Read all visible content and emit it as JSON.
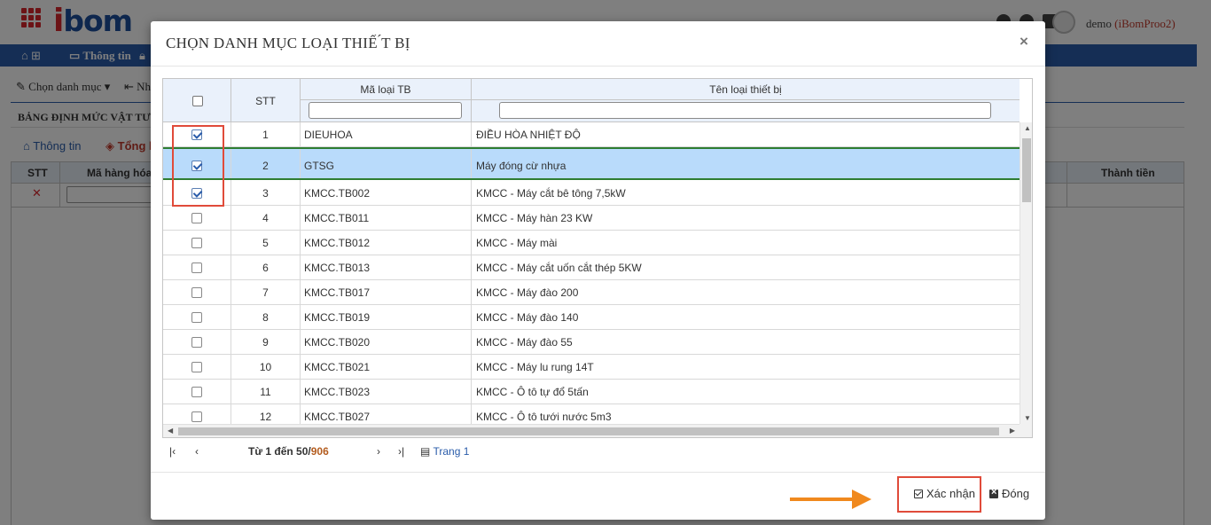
{
  "app": {
    "logo": "ibom",
    "user": "demo",
    "user_org": "(iBomProo2)",
    "nav": [
      "Thông tin"
    ],
    "toolbar": {
      "choose": "Chọn danh mục",
      "import": "Nh"
    },
    "section_title": "BẢNG ĐỊNH MỨC VẬT TƯ N",
    "tabs": [
      "Thông tin",
      "Tổng h"
    ],
    "bg_grid": {
      "headers": [
        "STT",
        "Mã hàng hóa",
        "Thành tiền"
      ]
    }
  },
  "modal": {
    "title": "CHỌN DANH MỤC LOẠI THIẾ ́T BỊ",
    "columns": {
      "stt": "STT",
      "code": "Mã loại TB",
      "name": "Tên loại thiết bị"
    },
    "rows": [
      {
        "stt": "1",
        "code": "DIEUHOA",
        "name": "ĐIỀU HÒA NHIỆT ĐỘ",
        "checked": true,
        "selected": false
      },
      {
        "stt": "2",
        "code": "GTSG",
        "name": "Máy đóng cừ nhựa",
        "checked": true,
        "selected": true
      },
      {
        "stt": "3",
        "code": "KMCC.TB002",
        "name": "KMCC - Máy cắt bê tông 7,5kW",
        "checked": true,
        "selected": false
      },
      {
        "stt": "4",
        "code": "KMCC.TB011",
        "name": "KMCC - Máy hàn 23 KW",
        "checked": false,
        "selected": false
      },
      {
        "stt": "5",
        "code": "KMCC.TB012",
        "name": "KMCC - Máy mài",
        "checked": false,
        "selected": false
      },
      {
        "stt": "6",
        "code": "KMCC.TB013",
        "name": "KMCC - Máy cắt uốn cắt thép 5KW",
        "checked": false,
        "selected": false
      },
      {
        "stt": "7",
        "code": "KMCC.TB017",
        "name": "KMCC - Máy đào 200",
        "checked": false,
        "selected": false
      },
      {
        "stt": "8",
        "code": "KMCC.TB019",
        "name": "KMCC - Máy đào 140",
        "checked": false,
        "selected": false
      },
      {
        "stt": "9",
        "code": "KMCC.TB020",
        "name": "KMCC - Máy đào 55",
        "checked": false,
        "selected": false
      },
      {
        "stt": "10",
        "code": "KMCC.TB021",
        "name": "KMCC - Máy lu rung 14T",
        "checked": false,
        "selected": false
      },
      {
        "stt": "11",
        "code": "KMCC.TB023",
        "name": "KMCC - Ô tô tự đổ 5tấn",
        "checked": false,
        "selected": false
      },
      {
        "stt": "12",
        "code": "KMCC.TB027",
        "name": "KMCC - Ô tô tưới nước 5m3",
        "checked": false,
        "selected": false
      }
    ],
    "pager": {
      "info": "Từ 1 đến 50/",
      "total": "906",
      "page": "Trang 1"
    },
    "buttons": {
      "confirm": "Xác nhận",
      "close": "Đóng"
    }
  },
  "colors": {
    "brand_blue": "#2a5caa",
    "brand_red": "#d9262c",
    "selected_row": "#b9dbfb",
    "annotation_red": "#e04b3a",
    "arrow_orange": "#f0891e"
  }
}
